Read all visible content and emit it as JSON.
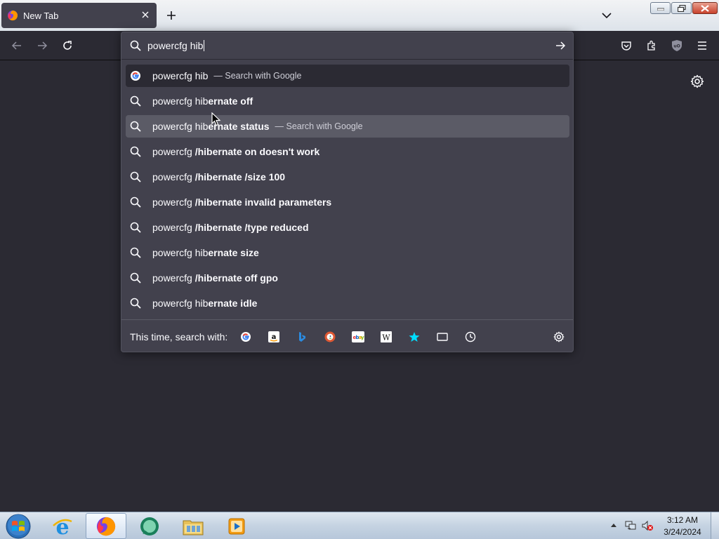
{
  "tab": {
    "title": "New Tab",
    "close_icon": "close-icon"
  },
  "toolbar": {
    "new_tab_icon": "plus-icon"
  },
  "urlbar": {
    "value": "powercfg hib",
    "go_icon": "arrow-right-icon",
    "results": [
      {
        "typed": "powercfg hib",
        "completion": "",
        "action": "— Search with Google",
        "icon": "google-icon",
        "state": "selected"
      },
      {
        "typed": "powercfg hib",
        "completion": "ernate off",
        "action": "",
        "icon": "search-icon",
        "state": ""
      },
      {
        "typed": "powercfg hib",
        "completion": "ernate status",
        "action": "— Search with Google",
        "icon": "search-icon",
        "state": "hovered"
      },
      {
        "typed": "powercfg ",
        "completion": "/hibernate on doesn't work",
        "action": "",
        "icon": "search-icon",
        "state": ""
      },
      {
        "typed": "powercfg ",
        "completion": "/hibernate /size 100",
        "action": "",
        "icon": "search-icon",
        "state": ""
      },
      {
        "typed": "powercfg ",
        "completion": "/hibernate invalid parameters",
        "action": "",
        "icon": "search-icon",
        "state": ""
      },
      {
        "typed": "powercfg ",
        "completion": "/hibernate /type reduced",
        "action": "",
        "icon": "search-icon",
        "state": ""
      },
      {
        "typed": "powercfg hib",
        "completion": "ernate size",
        "action": "",
        "icon": "search-icon",
        "state": ""
      },
      {
        "typed": "powercfg ",
        "completion": "/hibernate off gpo",
        "action": "",
        "icon": "search-icon",
        "state": ""
      },
      {
        "typed": "powercfg hib",
        "completion": "ernate idle",
        "action": "",
        "icon": "search-icon",
        "state": ""
      }
    ],
    "footer": {
      "label": "This time, search with:",
      "engines": [
        "google-icon",
        "amazon-icon",
        "bing-icon",
        "duckduckgo-icon",
        "ebay-icon",
        "wikipedia-icon",
        "bookmarks-star-icon",
        "tabs-icon",
        "history-clock-icon"
      ]
    }
  },
  "taskbar": {
    "clock_time": "3:12 AM",
    "clock_date": "3/24/2024"
  },
  "colors": {
    "browser_bg": "#2b2a33",
    "popup_bg": "#42414d",
    "hover_row": "#5b5b66"
  }
}
